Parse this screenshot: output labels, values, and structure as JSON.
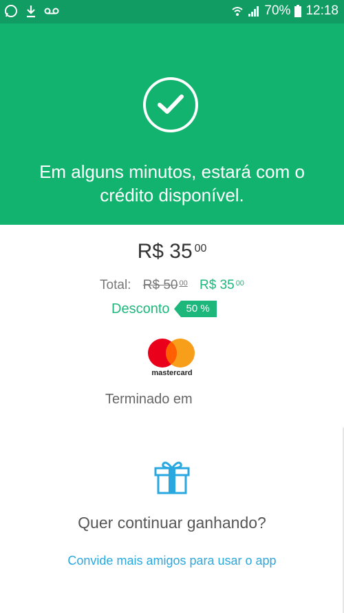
{
  "status_bar": {
    "battery": "70%",
    "time": "12:18",
    "left_icons": [
      "whatsapp-icon",
      "download-icon",
      "voicemail-icon"
    ],
    "right_icons": [
      "wifi-icon",
      "signal-icon",
      "battery-icon"
    ]
  },
  "hero": {
    "message": "Em alguns minutos, estará com o crédito disponível.",
    "icon": "check-circle-icon",
    "color": "#12b26f"
  },
  "price": {
    "main_currency": "R$",
    "main_value": "35",
    "main_cents": "00",
    "total_label": "Total:",
    "old_value": "R$ 50",
    "old_cents": "00",
    "new_value": "R$ 35",
    "new_cents": "00",
    "discount_label": "Desconto",
    "discount_badge": "50 %",
    "accent": "#1db77b"
  },
  "payment": {
    "brand": "mastercard",
    "terminated_label": "Terminado em"
  },
  "promo": {
    "icon": "gift-icon",
    "question": "Quer continuar ganhando?",
    "invite_link": "Convide mais amigos para usar o app",
    "link_color": "#29a8e0"
  }
}
